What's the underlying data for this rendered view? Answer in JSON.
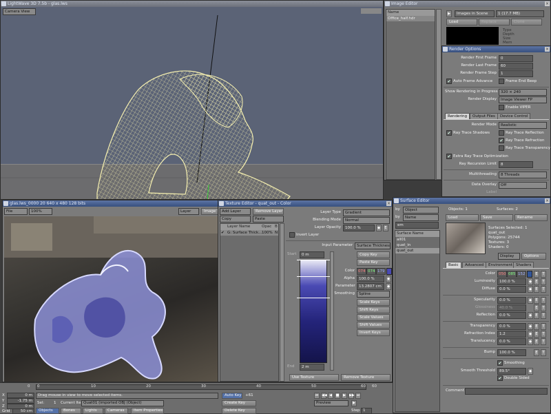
{
  "layout": {
    "title": "LightWave 3D 7.5b - glas.lws",
    "viewMode": "Camera View",
    "image_editor": {
      "title": "Image Editor",
      "list_header": "Name",
      "items": [
        "Office_half.hdr"
      ],
      "scene_label": "Images in Scene",
      "scene_count": "1 (17.7 MB)",
      "load": "Load",
      "replace": "Replace",
      "clone": "Clone",
      "info": [
        "Type",
        "Depth",
        "Size",
        "Mem"
      ]
    },
    "render_options": {
      "title": "Render Options",
      "first_frame_label": "Render First Frame",
      "first_frame": "0",
      "last_frame_label": "Render Last Frame",
      "last_frame": "60",
      "step_label": "Render Frame Step",
      "step": "1",
      "auto_frame": "Auto Frame Advance",
      "frame_end_beep": "Frame End Beep",
      "show_progress_label": "Show Rendering in Progress",
      "show_progress": "320 × 240",
      "render_display_label": "Render Display",
      "render_display": "Image Viewer FP",
      "enable_viper": "Enable VIPER",
      "tabs": [
        "Rendering",
        "Output Files",
        "Device Control"
      ],
      "render_mode_label": "Render Mode",
      "render_mode": "Realistic",
      "rt_shadows": "Ray Trace Shadows",
      "rt_reflection": "Ray Trace Reflection",
      "rt_refraction": "Ray Trace Refraction",
      "rt_transparency": "Ray Trace Transparency",
      "extra_rt": "Extra Ray Trace Optimization",
      "recursion_label": "Ray Recursion Limit",
      "recursion": "8",
      "multithreading_label": "Multithreading",
      "multithreading": "8 Threads",
      "data_overlay_label": "Data Overlay",
      "data_overlay": "Off",
      "label": "Label"
    },
    "render_window": {
      "title": "glas.lws_0000 20  640 x 480 128 bits",
      "file": "File",
      "zoom": "100%",
      "layer": "Layer",
      "image": "Image"
    },
    "texture_editor": {
      "title": "Texture Editor - quat_out - Color",
      "add_layer": "Add Layer",
      "remove_layer": "Remove Layer",
      "copy": "Copy",
      "paste": "Paste",
      "col_layer": "Layer Name",
      "col_opac": "Opac",
      "col_b": "B",
      "layer_name": "G: Surface Thick...",
      "layer_opac": "100%",
      "layer_b": "N",
      "layer_type_label": "Layer Type",
      "layer_type": "Gradient",
      "blending_label": "Blending Mode",
      "blending": "Normal",
      "opacity_label": "Layer Opacity",
      "opacity": "100.0 %",
      "invert": "Invert Layer",
      "input_param_label": "Input Parameter",
      "input_param": "Surface Thickness",
      "start_label": "Start",
      "start": "0 m",
      "end_label": "End",
      "end": "2 m",
      "copy_key": "Copy Key",
      "paste_key": "Paste Key",
      "color_label": "Color",
      "color_r": "074",
      "color_g": "074",
      "color_b": "179",
      "alpha_label": "Alpha",
      "alpha": "100.0 %",
      "param_label": "Parameter",
      "param": "13.2807 cm",
      "smoothing_label": "Smoothing",
      "smoothing": "Spline",
      "scale_keys": "Scale Keys",
      "shift_keys": "Shift Keys",
      "scale_values": "Scale Values",
      "shift_values": "Shift Values",
      "invert_keys": "Invert Keys",
      "use_texture": "Use Texture",
      "remove_texture": "Remove Texture"
    },
    "surface_editor": {
      "title": "Surface Editor",
      "edit_by_label": "by",
      "edit_by": "Object",
      "filter_label": "by",
      "filter": "Name",
      "filter_placeholder": "em",
      "list_header": "Surface Name",
      "surfaces": [
        "all01",
        "quat_in",
        "quat_out"
      ],
      "objects": "Objects: 1",
      "surfaces_count": "Surfaces: 2",
      "load": "Load",
      "save": "Save",
      "rename": "Rename",
      "selected": "Surfaces Selected: 1",
      "name": "quat_out",
      "polygons": "Polygons: 25744",
      "textures": "Textures: 3",
      "shaders": "Shaders: 0",
      "display": "Display",
      "options": "Options",
      "tabs": [
        "Basic",
        "Advanced",
        "Environment",
        "Shaders"
      ],
      "color_label": "Color",
      "color_r": "050",
      "color_g": "085",
      "color_b": "152",
      "luminosity_label": "Luminosity",
      "luminosity": "100.0 %",
      "diffuse_label": "Diffuse",
      "diffuse": "0.0 %",
      "specularity_label": "Specularity",
      "specularity": "0.0 %",
      "glossiness_label": "Glossiness",
      "glossiness": "40.0 %",
      "reflection_label": "Reflection",
      "reflection": "0.0 %",
      "transparency_label": "Transparency",
      "transparency": "0.0 %",
      "refraction_label": "Refraction Index",
      "refraction": "1.2",
      "translucency_label": "Translucency",
      "translucency": "0.0 %",
      "bump_label": "Bump",
      "bump": "100.0 %",
      "smoothing": "Smoothing",
      "smooth_threshold_label": "Smooth Threshold",
      "smooth_threshold": "89.5°",
      "double_sided": "Double Sided",
      "comment_label": "Comment"
    },
    "timeline": {
      "ticks": [
        "0",
        "10",
        "20",
        "30",
        "40",
        "50",
        "60"
      ],
      "x": "X",
      "y": "Y",
      "z": "Z",
      "grid": "Grid",
      "x_val": "0 m",
      "y_val": "-1.75 m",
      "z_val": "0 m",
      "grid_val": "50 cm",
      "status": "Drag mouse in view to move selected items.",
      "sel": "Sel:",
      "sel_count": "1",
      "current_item_label": "Current Item",
      "current_item": "Quat01 (imported OBJ (Object)",
      "objects": "Objects",
      "bones": "Bones",
      "lights": "Lights",
      "cameras": "Cameras",
      "item_properties": "Item Properties",
      "auto_key": "Auto Key",
      "auto_key_val": "+61",
      "create_key": "Create Key",
      "delete_key": "Delete Key",
      "preview": "Preview",
      "step_label": "Step",
      "step": "1",
      "frame": "0",
      "frame_end": "60"
    }
  },
  "chart_data": {}
}
